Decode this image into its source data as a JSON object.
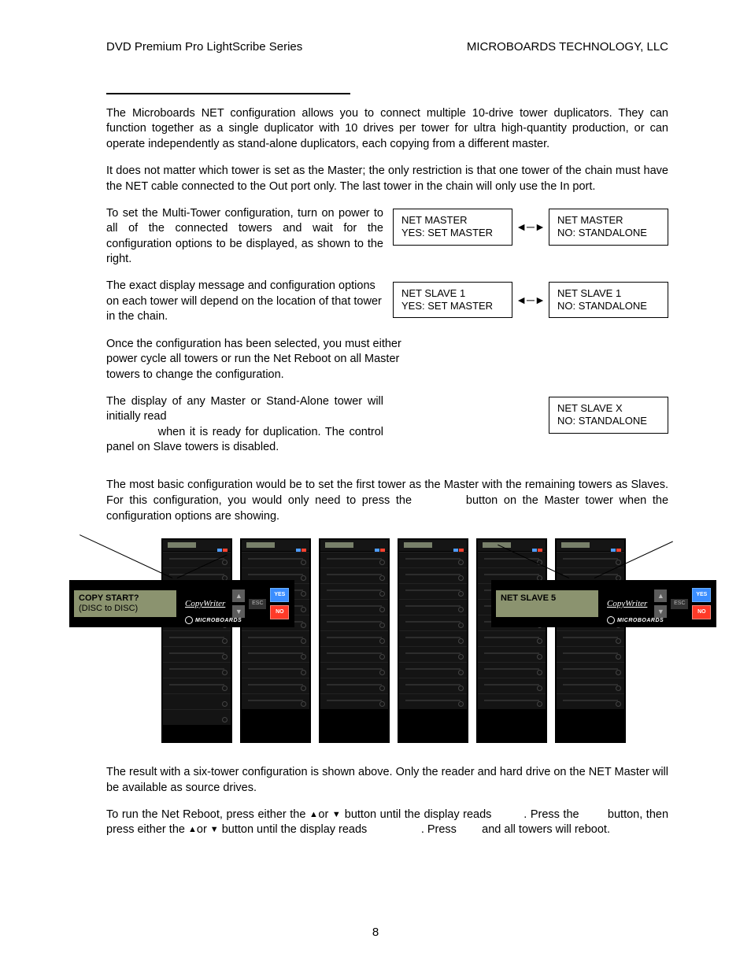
{
  "header": {
    "left": "DVD Premium Pro LightScribe Series",
    "right": "MICROBOARDS TECHNOLOGY, LLC"
  },
  "p1": "The Microboards NET configuration allows you to connect multiple 10-drive tower duplicators. They can function together as a single duplicator with 10 drives per tower for ultra high-quantity production, or can operate independently as stand-alone duplicators, each copying from a different master.",
  "p2": "It does not matter which tower is set as the Master; the only restriction is that one tower of the chain must have the NET cable connected to the Out port only.  The last tower in the chain will only use the In port.",
  "p3": "To set the Multi-Tower configuration, turn on power to all of the connected towers and wait for the configuration options to be displayed, as shown to the right.",
  "p4": "The exact display message and configuration options on each tower will depend on the location of that tower in the chain.",
  "p5": "Once the configuration has been selected, you must either power cycle all towers or run the Net Reboot on all Master towers to change the configuration.",
  "p6a": "The display of any Master or Stand-Alone tower will initially read",
  "p6b": " when it is ready for duplication.  The control panel on Slave towers is disabled.",
  "p7a": "The most basic configuration would be to set the first tower as the Master with the remaining towers as Slaves.  For this configuration, you would only need to press the ",
  "p7b": " button on the Master tower when the configuration options are showing.",
  "p8": "The result with a six-tower configuration is shown above.  Only the reader and hard drive on the NET Master will be available as source drives.",
  "p9a": "To run the Net Reboot, press either the ",
  "p9_tri1": "▲",
  "p9_or1": "or ",
  "p9_tri2": "▼",
  "p9b": " button until the display reads ",
  "p9c": ".  Press the ",
  "p9d": " button, then press either the ",
  "p9_tri3": "▲",
  "p9_or2": "or ",
  "p9_tri4": "▼",
  "p9e": " button until the display reads ",
  "p9f": ".  Press ",
  "p9g": " and all towers will reboot.",
  "boxes": {
    "a1_l1": "NET MASTER",
    "a1_l2": "YES: SET MASTER",
    "a2_l1": "NET MASTER",
    "a2_l2": "NO: STANDALONE",
    "b1_l1": "NET SLAVE 1",
    "b1_l2": "YES: SET MASTER",
    "b2_l1": "NET SLAVE 1",
    "b2_l2": "NO: STANDALONE",
    "c_l1": "NET SLAVE X",
    "c_l2": "NO: STANDALONE"
  },
  "callouts": {
    "master_l1": "COPY START?",
    "master_l2": "(DISC to DISC)",
    "slave_l1": "NET SLAVE  5",
    "brand": "CopyWriter",
    "micro": "MICROBOARDS",
    "yes": "YES",
    "no": "NO",
    "esc": "ESC",
    "up": "▲",
    "down": "▼"
  },
  "arrow_double": "◄─►",
  "page_number": "8"
}
